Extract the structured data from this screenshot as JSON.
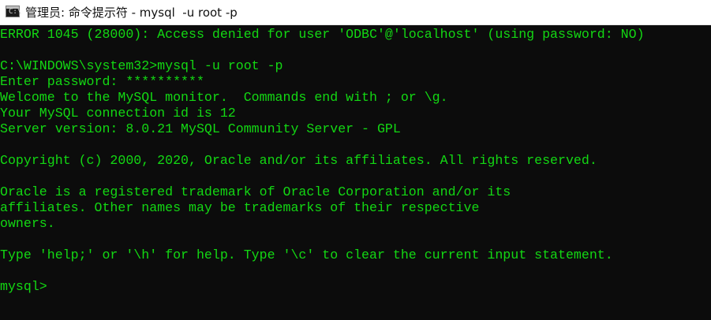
{
  "window": {
    "title": "管理员: 命令提示符 - mysql  -u root -p",
    "icon": "cmd-icon",
    "icon_glyph": "C:\\"
  },
  "colors": {
    "console_background": "#0c0c0c",
    "console_text": "#13d813",
    "titlebar_background": "#ffffff"
  },
  "console": {
    "lines": [
      "ERROR 1045 (28000): Access denied for user 'ODBC'@'localhost' (using password: NO)",
      "",
      "C:\\WINDOWS\\system32>mysql -u root -p",
      "Enter password: **********",
      "Welcome to the MySQL monitor.  Commands end with ; or \\g.",
      "Your MySQL connection id is 12",
      "Server version: 8.0.21 MySQL Community Server - GPL",
      "",
      "Copyright (c) 2000, 2020, Oracle and/or its affiliates. All rights reserved.",
      "",
      "Oracle is a registered trademark of Oracle Corporation and/or its",
      "affiliates. Other names may be trademarks of their respective",
      "owners.",
      "",
      "Type 'help;' or '\\h' for help. Type '\\c' to clear the current input statement.",
      "",
      "mysql>"
    ]
  }
}
